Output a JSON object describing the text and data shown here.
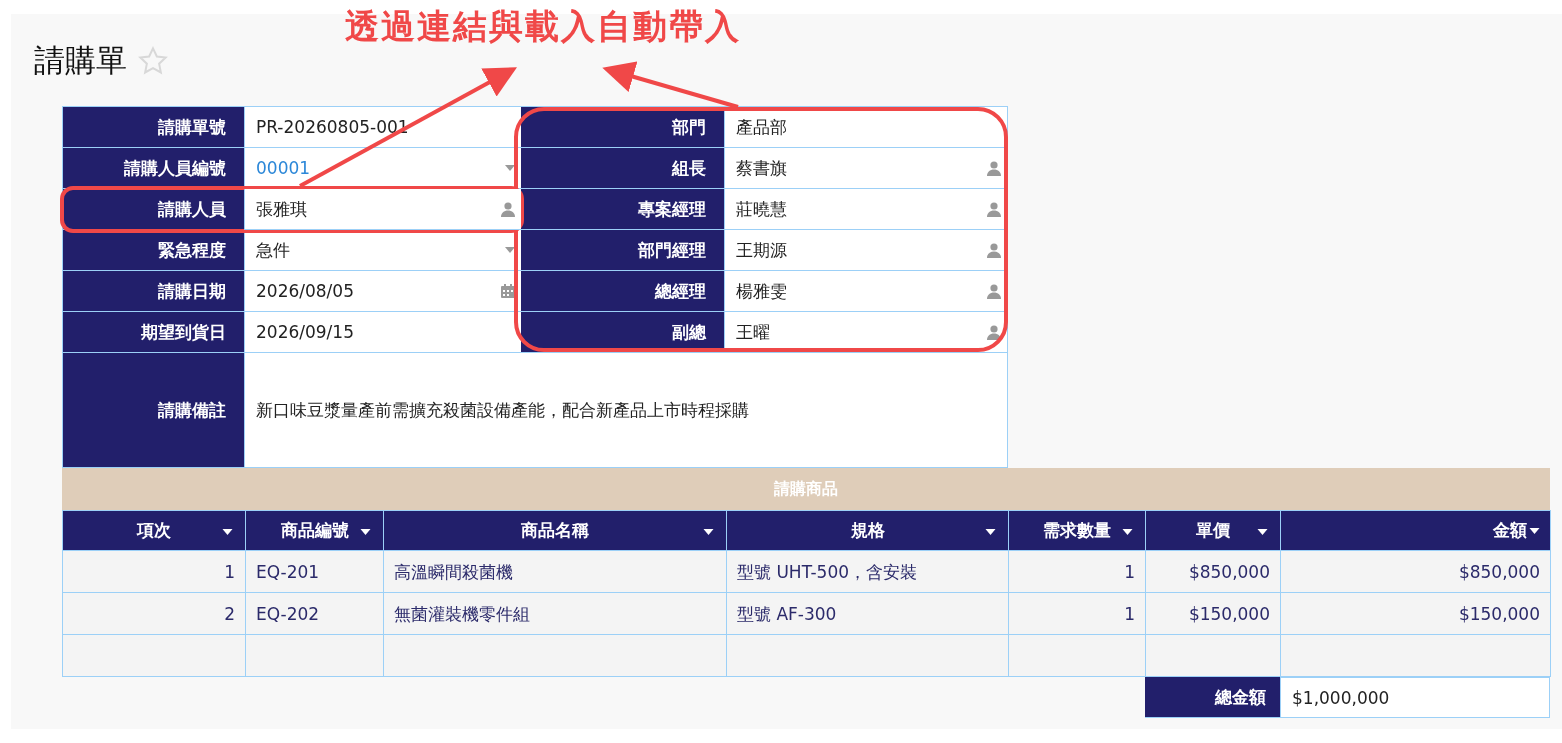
{
  "annotation": {
    "text": "透過連結與載入自動帶入"
  },
  "page": {
    "title": "請購單",
    "favorite": false
  },
  "form": {
    "left": [
      {
        "label": "請購單號",
        "value": "PR-20260805-001",
        "kind": "text",
        "highlighted": false
      },
      {
        "label": "請購人員編號",
        "value": "00001",
        "kind": "link-dropdown",
        "highlighted": false
      },
      {
        "label": "請購人員",
        "value": "張雅琪",
        "kind": "person",
        "highlighted": true
      },
      {
        "label": "緊急程度",
        "value": "急件",
        "kind": "dropdown",
        "highlighted": false
      },
      {
        "label": "請購日期",
        "value": "2026/08/05",
        "kind": "date",
        "highlighted": false
      },
      {
        "label": "期望到貨日",
        "value": "2026/09/15",
        "kind": "text",
        "highlighted": false
      }
    ],
    "right": [
      {
        "label": "部門",
        "value": "產品部",
        "kind": "text"
      },
      {
        "label": "組長",
        "value": "蔡書旗",
        "kind": "person"
      },
      {
        "label": "專案經理",
        "value": "莊曉慧",
        "kind": "person"
      },
      {
        "label": "部門經理",
        "value": "王期源",
        "kind": "person"
      },
      {
        "label": "總經理",
        "value": "楊雅雯",
        "kind": "person"
      },
      {
        "label": "副總",
        "value": "王曜",
        "kind": "person"
      }
    ],
    "right_highlighted": true,
    "remarks": {
      "label": "請購備註",
      "value": "新口味豆漿量產前需擴充殺菌設備產能，配合新產品上市時程採購"
    }
  },
  "items": {
    "title": "請購商品",
    "columns": [
      {
        "label": "項次"
      },
      {
        "label": "商品編號"
      },
      {
        "label": "商品名稱"
      },
      {
        "label": "規格"
      },
      {
        "label": "需求數量"
      },
      {
        "label": "單價"
      },
      {
        "label": "金額"
      }
    ],
    "rows": [
      [
        "1",
        "EQ-201",
        "高溫瞬間殺菌機",
        "型號 UHT-500，含安裝",
        "1",
        "$850,000",
        "$850,000"
      ],
      [
        "2",
        "EQ-202",
        "無菌灌裝機零件組",
        "型號 AF-300",
        "1",
        "$150,000",
        "$150,000"
      ]
    ],
    "total": {
      "label": "總金額",
      "value": "$1,000,000"
    }
  }
}
